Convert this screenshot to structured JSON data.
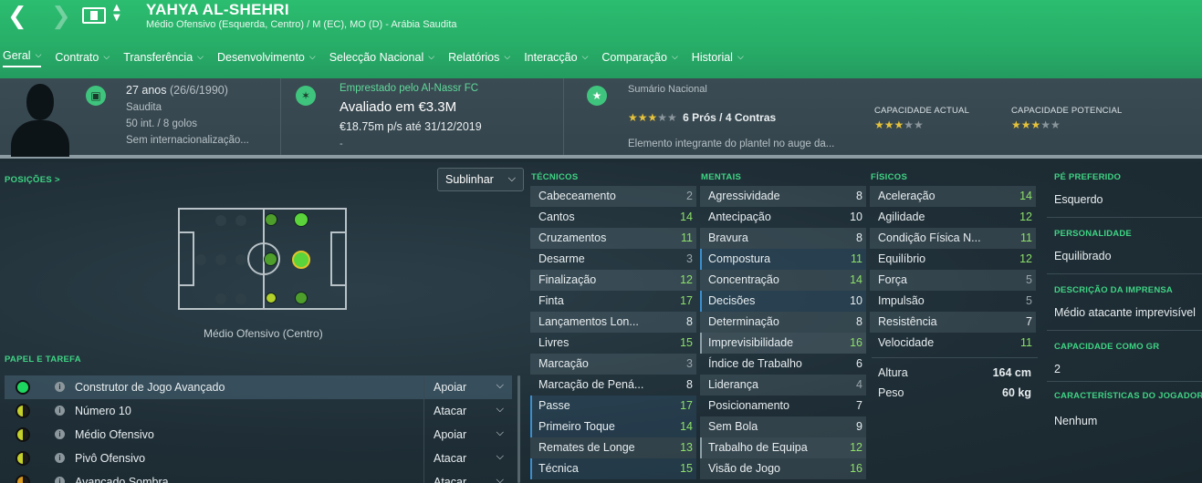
{
  "header": {
    "name": "YAHYA AL-SHEHRI",
    "subtitle": "Médio Ofensivo (Esquerda, Centro) / M (EC), MO (D) - Arábia Saudita"
  },
  "tabs": [
    {
      "label": "Geral"
    },
    {
      "label": "Contrato"
    },
    {
      "label": "Transferência"
    },
    {
      "label": "Desenvolvimento"
    },
    {
      "label": "Selecção Nacional"
    },
    {
      "label": "Relatórios"
    },
    {
      "label": "Interacção"
    },
    {
      "label": "Comparação"
    },
    {
      "label": "Historial"
    }
  ],
  "info": {
    "age": "27 anos",
    "dob": "(26/6/1990)",
    "nationality": "Saudita",
    "caps": "50 int. / 8 golos",
    "international": "Sem internacionalização...",
    "loan": "Emprestado pelo Al-Nassr FC",
    "value": "Avaliado em €3.3M",
    "wage": "€18.75m p/s até 31/12/2019",
    "dash": "-",
    "summary_title": "Sumário Nacional",
    "pros_cons": "6 Prós / 4 Contras",
    "summary_text": "Elemento integrante do plantel no auge da...",
    "summary_stars": 3,
    "cap_actual_label": "CAPACIDADE ACTUAL",
    "cap_actual_stars": 3,
    "cap_potencial_label": "CAPACIDADE POTENCIAL",
    "cap_potencial_stars": 3
  },
  "positions": {
    "label": "POSIÇÕES",
    "dropdown": "Sublinhar",
    "position_label": "Médio Ofensivo (Centro)"
  },
  "roles": {
    "label": "PAPEL E TAREFA",
    "items": [
      {
        "name": "Construtor de Jogo Avançado",
        "duty": "Apoiar",
        "color": "#1ed760"
      },
      {
        "name": "Número 10",
        "duty": "Atacar",
        "color": "#c4d12a"
      },
      {
        "name": "Médio Ofensivo",
        "duty": "Apoiar",
        "color": "#c4d12a"
      },
      {
        "name": "Pivô Ofensivo",
        "duty": "Atacar",
        "color": "#c4d12a"
      },
      {
        "name": "Avançado Sombra",
        "duty": "Atacar",
        "color": "#d79a1e"
      }
    ]
  },
  "tecnicos": {
    "label": "TÉCNICOS",
    "items": [
      {
        "name": "Cabeceamento",
        "value": "2"
      },
      {
        "name": "Cantos",
        "value": "14"
      },
      {
        "name": "Cruzamentos",
        "value": "11"
      },
      {
        "name": "Desarme",
        "value": "3"
      },
      {
        "name": "Finalização",
        "value": "12"
      },
      {
        "name": "Finta",
        "value": "17"
      },
      {
        "name": "Lançamentos Lon...",
        "value": "8"
      },
      {
        "name": "Livres",
        "value": "15"
      },
      {
        "name": "Marcação",
        "value": "3"
      },
      {
        "name": "Marcação de Pená...",
        "value": "8"
      },
      {
        "name": "Passe",
        "value": "17"
      },
      {
        "name": "Primeiro Toque",
        "value": "14"
      },
      {
        "name": "Remates de Longe",
        "value": "13"
      },
      {
        "name": "Técnica",
        "value": "15"
      }
    ]
  },
  "mentais": {
    "label": "MENTAIS",
    "items": [
      {
        "name": "Agressividade",
        "value": "8"
      },
      {
        "name": "Antecipação",
        "value": "10"
      },
      {
        "name": "Bravura",
        "value": "8"
      },
      {
        "name": "Compostura",
        "value": "11"
      },
      {
        "name": "Concentração",
        "value": "14"
      },
      {
        "name": "Decisões",
        "value": "10"
      },
      {
        "name": "Determinação",
        "value": "8"
      },
      {
        "name": "Imprevisibilidade",
        "value": "16"
      },
      {
        "name": "Índice de Trabalho",
        "value": "6"
      },
      {
        "name": "Liderança",
        "value": "4"
      },
      {
        "name": "Posicionamento",
        "value": "7"
      },
      {
        "name": "Sem Bola",
        "value": "9"
      },
      {
        "name": "Trabalho de Equipa",
        "value": "12"
      },
      {
        "name": "Visão de Jogo",
        "value": "16"
      }
    ]
  },
  "fisicos": {
    "label": "FÍSICOS",
    "items": [
      {
        "name": "Aceleração",
        "value": "14"
      },
      {
        "name": "Agilidade",
        "value": "12"
      },
      {
        "name": "Condição Física N...",
        "value": "11"
      },
      {
        "name": "Equilíbrio",
        "value": "12"
      },
      {
        "name": "Força",
        "value": "5"
      },
      {
        "name": "Impulsão",
        "value": "5"
      },
      {
        "name": "Resistência",
        "value": "7"
      },
      {
        "name": "Velocidade",
        "value": "11"
      }
    ],
    "altura_label": "Altura",
    "altura": "164 cm",
    "peso_label": "Peso",
    "peso": "60 kg"
  },
  "right": [
    {
      "label": "PÉ PREFERIDO",
      "value": "Esquerdo"
    },
    {
      "label": "PERSONALIDADE",
      "value": "Equilibrado"
    },
    {
      "label": "DESCRIÇÃO DA IMPRENSA",
      "value": "Médio atacante imprevisível"
    },
    {
      "label": "CAPACIDADE COMO GR",
      "value": "2"
    },
    {
      "label": "CARACTERÍSTICAS DO JOGADOR",
      "value": "Nenhum"
    }
  ],
  "colors": {
    "accent": "#2bbd70",
    "high_value": "#8de06a"
  }
}
